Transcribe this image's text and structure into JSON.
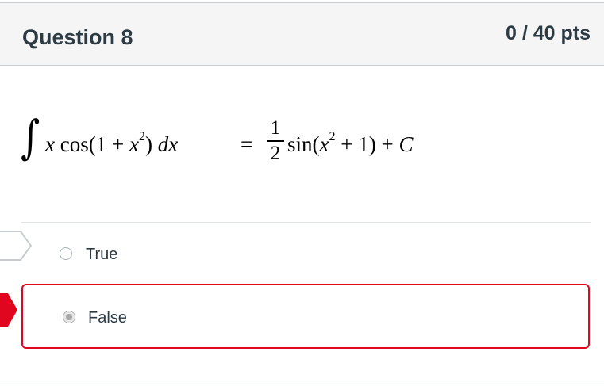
{
  "question": {
    "title": "Question 8",
    "points": "0 / 40 pts"
  },
  "math": {
    "integral_sign": "∫",
    "lhs_x": "x",
    "lhs_cos": " cos(1 + ",
    "lhs_x2": "x",
    "lhs_exp": "2",
    "lhs_close": ") ",
    "lhs_dx": "dx",
    "equals": "=",
    "frac_num": "1",
    "frac_den": "2",
    "rhs_sin": "sin(",
    "rhs_x": "x",
    "rhs_exp": "2",
    "rhs_tail": " + 1) + ",
    "rhs_c": "C"
  },
  "answers": [
    {
      "label": "True",
      "selected": false,
      "marker": "correct-answer-arrow-icon"
    },
    {
      "label": "False",
      "selected": true,
      "marker": "incorrect-answer-arrow-icon"
    }
  ],
  "colors": {
    "incorrect": "#e0061f",
    "header_bg": "#f5f5f5",
    "text": "#2d3b45"
  }
}
